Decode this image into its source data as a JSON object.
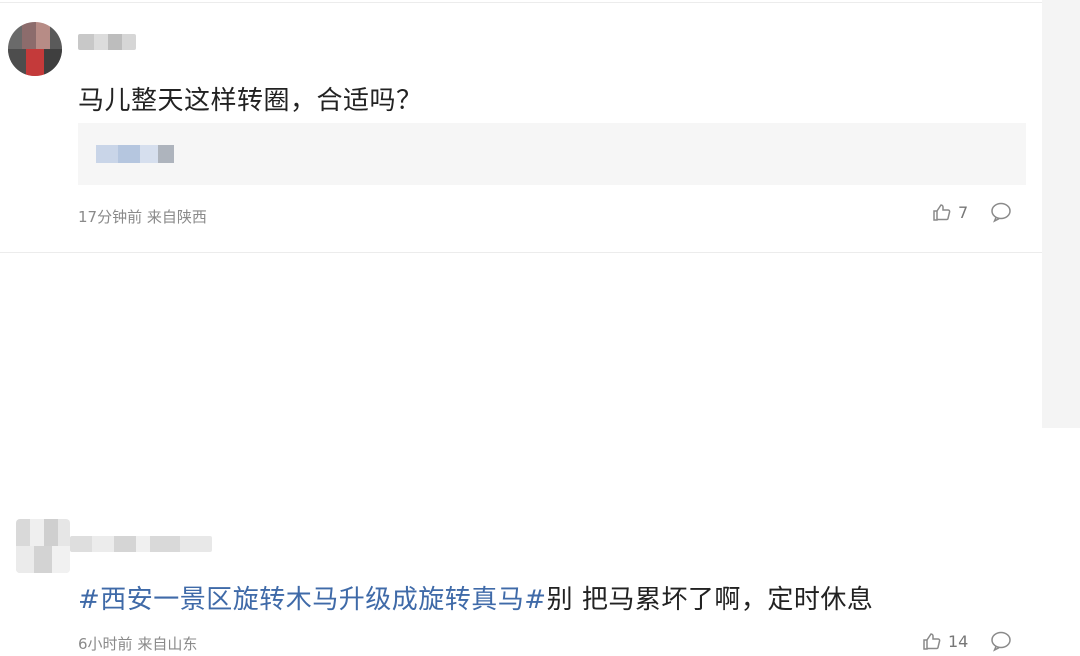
{
  "comments": [
    {
      "text": "马儿整天这样转圈，合适吗？",
      "time": "17分钟前",
      "location": "来自陕西",
      "likes": "7",
      "has_quote": true
    },
    {
      "hashtag": "#西安一景区旋转木马升级成旋转真马#",
      "text": "别 把马累坏了啊，定时休息",
      "time": "6小时前",
      "location": "来自山东",
      "likes": "14"
    }
  ],
  "icons": {
    "like": "thumbs-up-icon",
    "reply": "comment-bubble-icon"
  },
  "colors": {
    "hashtag": "#3f6aa8",
    "meta_text": "#8a8a8a",
    "quote_bg": "#f6f6f6"
  }
}
